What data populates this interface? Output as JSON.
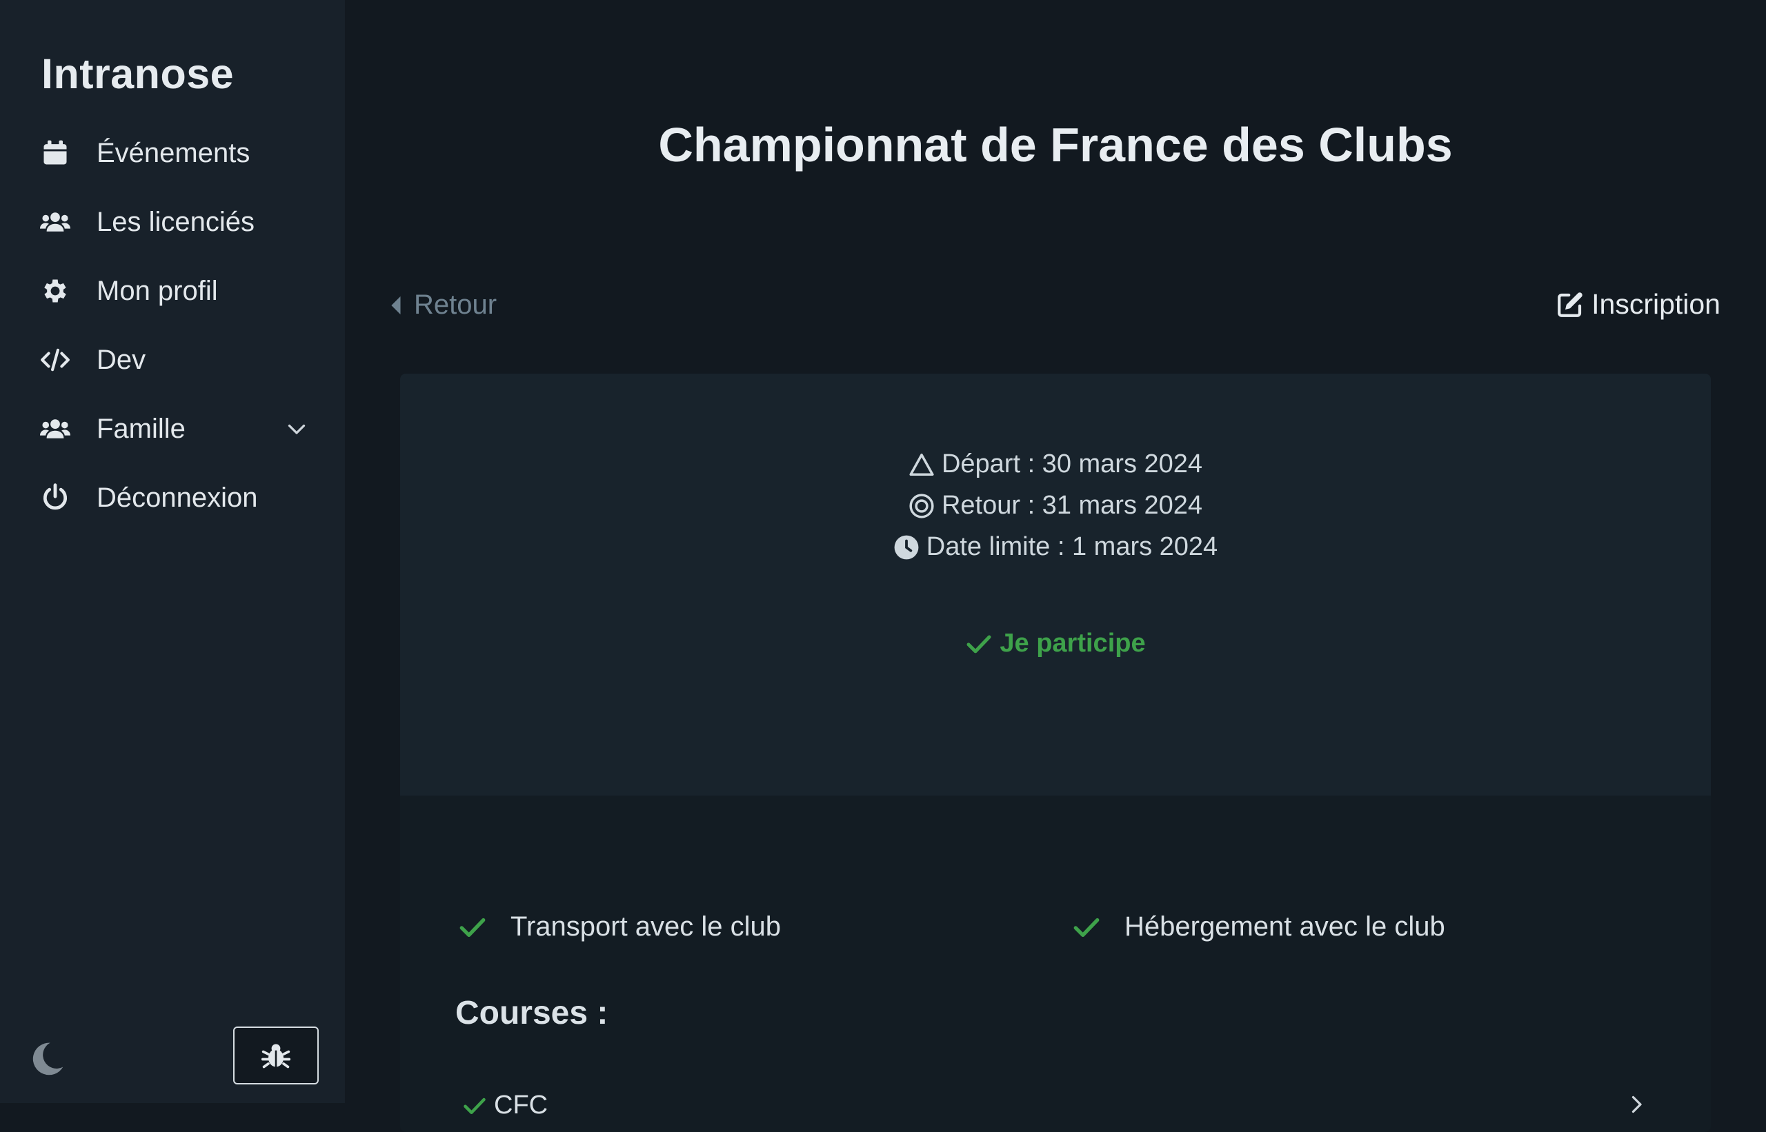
{
  "app": {
    "title": "Intranose"
  },
  "sidebar": {
    "items": [
      {
        "label": "Événements",
        "icon": "calendar-icon"
      },
      {
        "label": "Les licenciés",
        "icon": "users-icon"
      },
      {
        "label": "Mon profil",
        "icon": "gear-icon"
      },
      {
        "label": "Dev",
        "icon": "code-icon"
      },
      {
        "label": "Famille",
        "icon": "users-icon",
        "expandable": true
      },
      {
        "label": "Déconnexion",
        "icon": "power-icon"
      }
    ],
    "footer": {
      "theme_icon": "moon-icon",
      "bug_icon": "bug-icon"
    }
  },
  "page": {
    "title": "Championnat de France des Clubs",
    "back_label": "Retour",
    "signup_label": "Inscription"
  },
  "event": {
    "depart": "Départ : 30 mars 2024",
    "retour": "Retour : 31 mars 2024",
    "deadline": "Date limite : 1 mars 2024",
    "status": "Je participe",
    "options": [
      "Transport avec le club",
      "Hébergement avec le club"
    ],
    "courses_title": "Courses :",
    "courses": [
      "CFC"
    ]
  },
  "colors": {
    "background": "#121920",
    "sidebar": "#18212a",
    "card_top": "#18232c",
    "success": "#3ea24a",
    "muted": "#6f8290"
  }
}
